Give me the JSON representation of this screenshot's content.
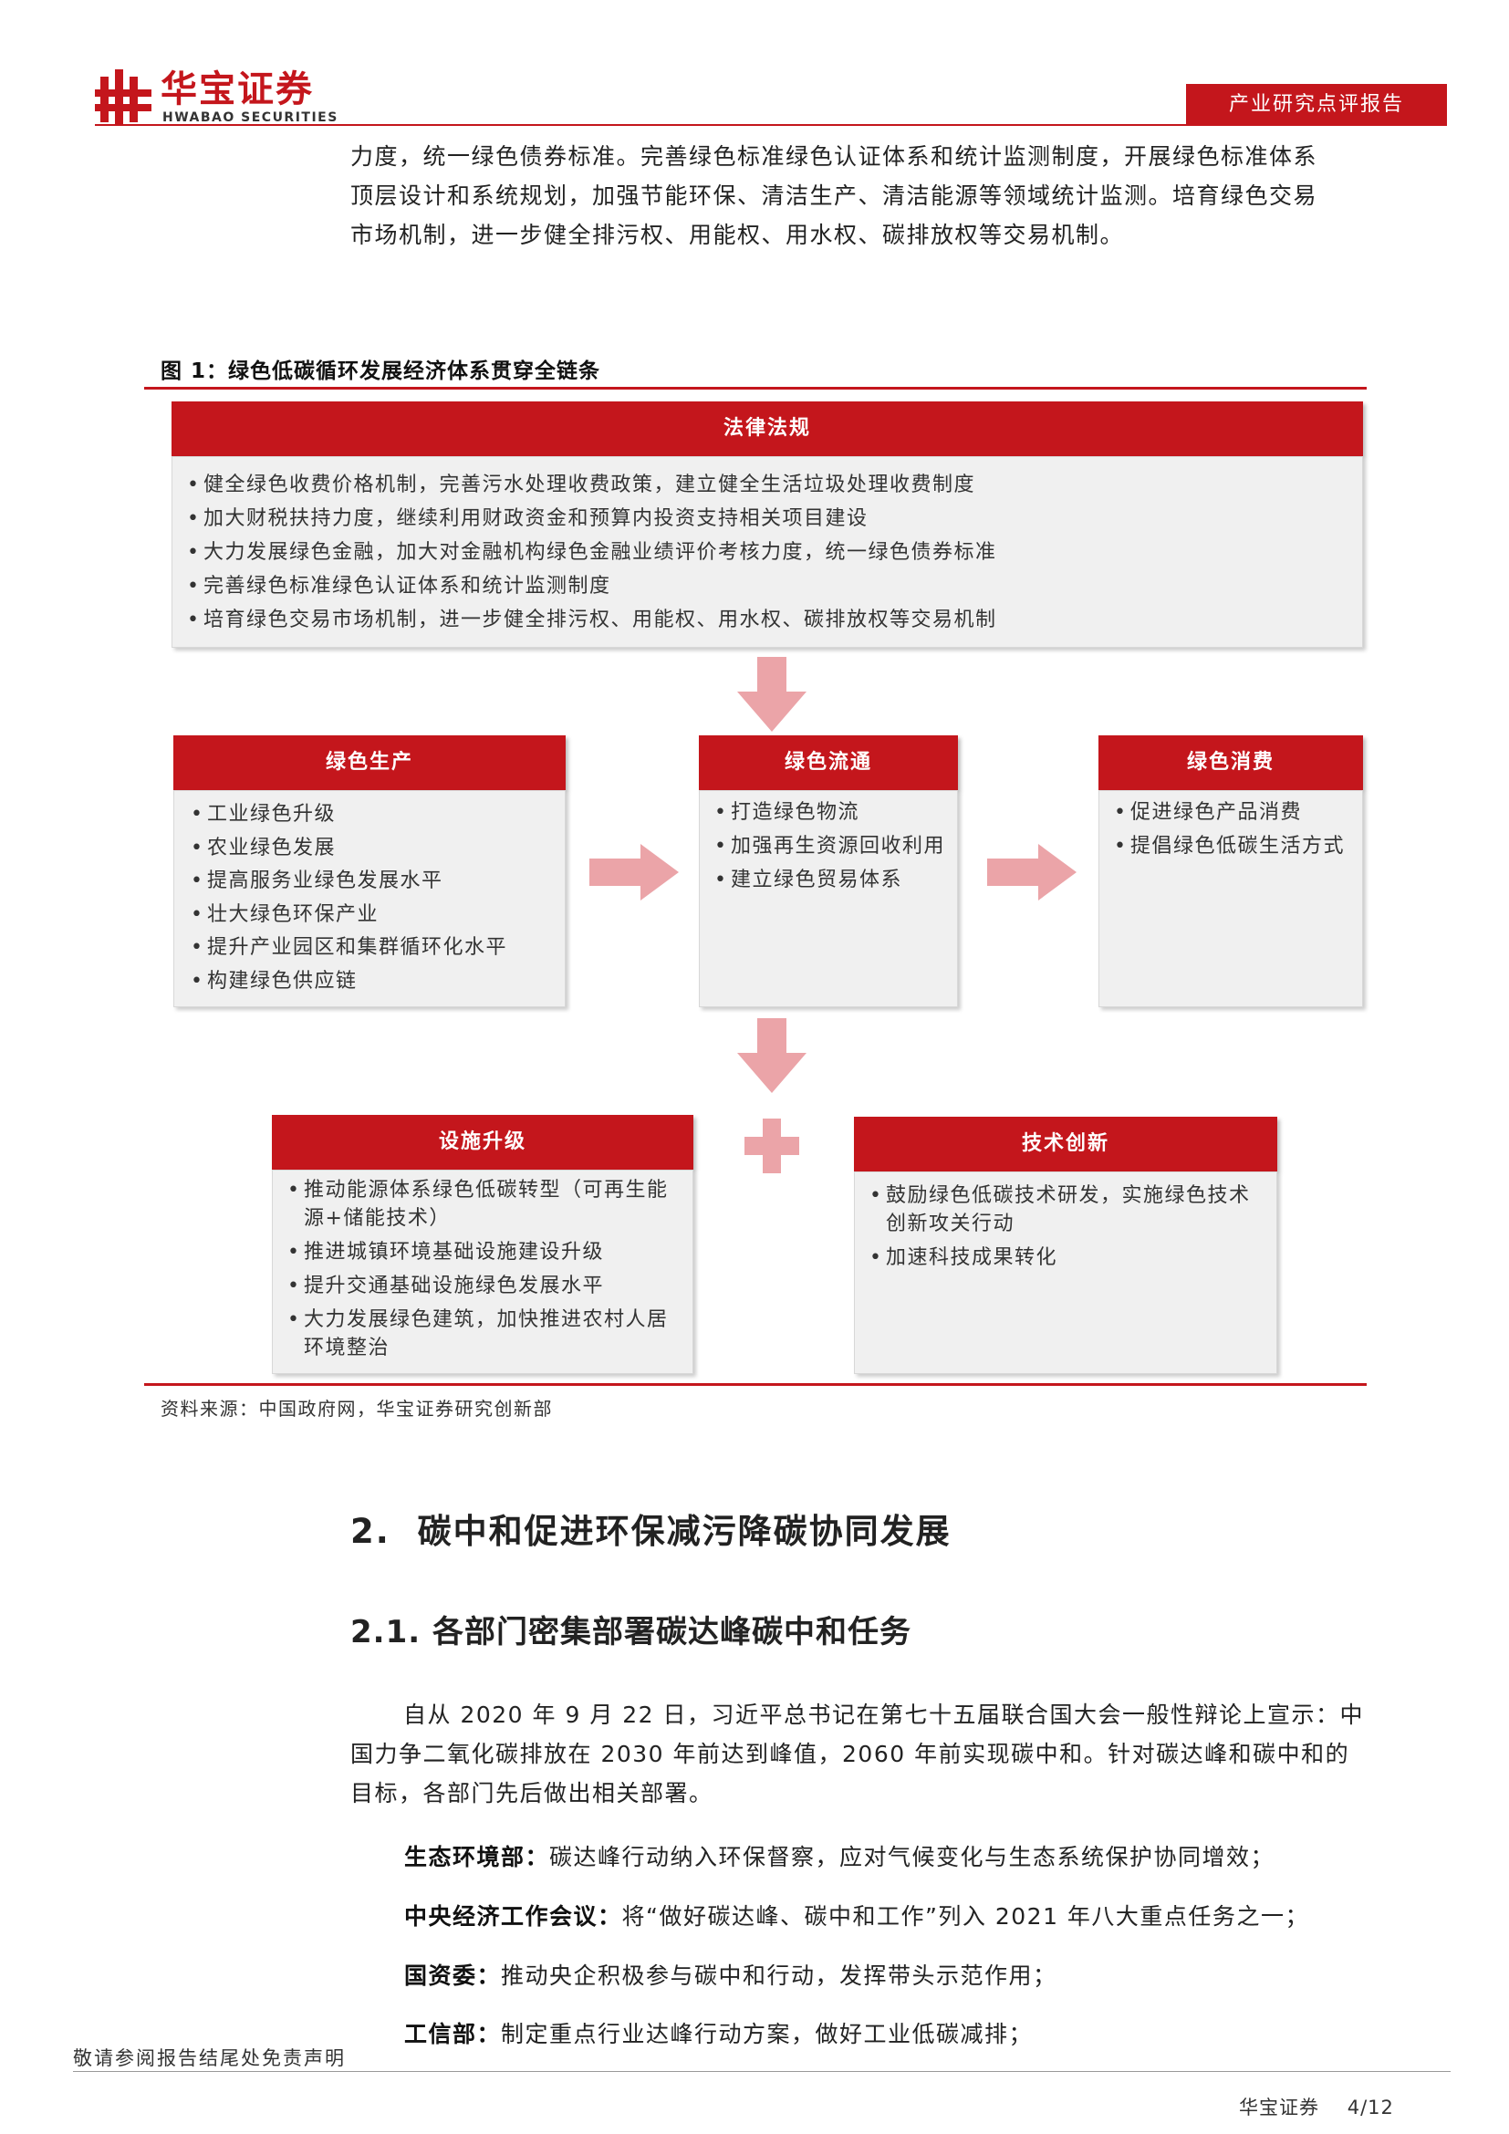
{
  "header": {
    "logo_cn": "华宝证券",
    "logo_en": "HWABAO SECURITIES",
    "report_type": "产业研究点评报告"
  },
  "intro_lines": [
    "力度，统一绿色债券标准。完善绿色标准绿色认证体系和统计监测制度，开展绿色标准体系",
    "顶层设计和系统规划，加强节能环保、清洁生产、清洁能源等领域统计监测。培育绿色交易",
    "市场机制，进一步健全排污权、用能权、用水权、碳排放权等交易机制。"
  ],
  "figure": {
    "title": "图 1：绿色低碳循环发展经济体系贯穿全链条",
    "law": {
      "title": "法律法规",
      "items": [
        "健全绿色收费价格机制，完善污水处理收费政策，建立健全生活垃圾处理收费制度",
        "加大财税扶持力度，继续利用财政资金和预算内投资支持相关项目建设",
        "大力发展绿色金融，加大对金融机构绿色金融业绩评价考核力度，统一绿色债券标准",
        "完善绿色标准绿色认证体系和统计监测制度",
        "培育绿色交易市场机制，进一步健全排污权、用能权、用水权、碳排放权等交易机制"
      ]
    },
    "production": {
      "title": "绿色生产",
      "items": [
        "工业绿色升级",
        "农业绿色发展",
        "提高服务业绿色发展水平",
        "壮大绿色环保产业",
        "提升产业园区和集群循环化水平",
        "构建绿色供应链"
      ]
    },
    "circulation": {
      "title": "绿色流通",
      "items": [
        "打造绿色物流",
        "加强再生资源回收利用",
        "建立绿色贸易体系"
      ]
    },
    "consumption": {
      "title": "绿色消费",
      "items": [
        "促进绿色产品消费",
        "提倡绿色低碳生活方式"
      ]
    },
    "infrastructure": {
      "title": "设施升级",
      "items": [
        "推动能源体系绿色低碳转型（可再生能源+储能技术）",
        "推进城镇环境基础设施建设升级",
        "提升交通基础设施绿色发展水平",
        "大力发展绿色建筑，加快推进农村人居环境整治"
      ]
    },
    "innovation": {
      "title": "技术创新",
      "items": [
        "鼓励绿色低碳技术研发，实施绿色技术创新攻关行动",
        "加速科技成果转化"
      ]
    },
    "source": "资料来源：中国政府网，华宝证券研究创新部"
  },
  "section2": {
    "number": "2.",
    "title": "碳中和促进环保减污降碳协同发展"
  },
  "section21": {
    "number": "2.1.",
    "title": "各部门密集部署碳达峰碳中和任务"
  },
  "body_lines": [
    "自从 2020 年 9 月 22 日，习近平总书记在第七十五届联合国大会一般性辩论上宣示：中",
    "国力争二氧化碳排放在 2030 年前达到峰值，2060 年前实现碳中和。针对碳达峰和碳中和的",
    "目标，各部门先后做出相关部署。"
  ],
  "departments": [
    {
      "name": "生态环境部：",
      "text": "碳达峰行动纳入环保督察，应对气候变化与生态系统保护协同增效；"
    },
    {
      "name": "中央经济工作会议：",
      "text": "将“做好碳达峰、碳中和工作”列入 2021 年八大重点任务之一；"
    },
    {
      "name": "国资委：",
      "text": "推动央企积极参与碳中和行动，发挥带头示范作用；"
    },
    {
      "name": "工信部：",
      "text": "制定重点行业达峰行动方案，做好工业低碳减排；"
    }
  ],
  "footer": {
    "disclaimer": "敬请参阅报告结尾处免责声明",
    "brand": "华宝证券",
    "page": "4/12"
  },
  "colors": {
    "accent": "#c4161c",
    "arrow": "#eba4a8",
    "box_bg": "#f0f0f0"
  }
}
